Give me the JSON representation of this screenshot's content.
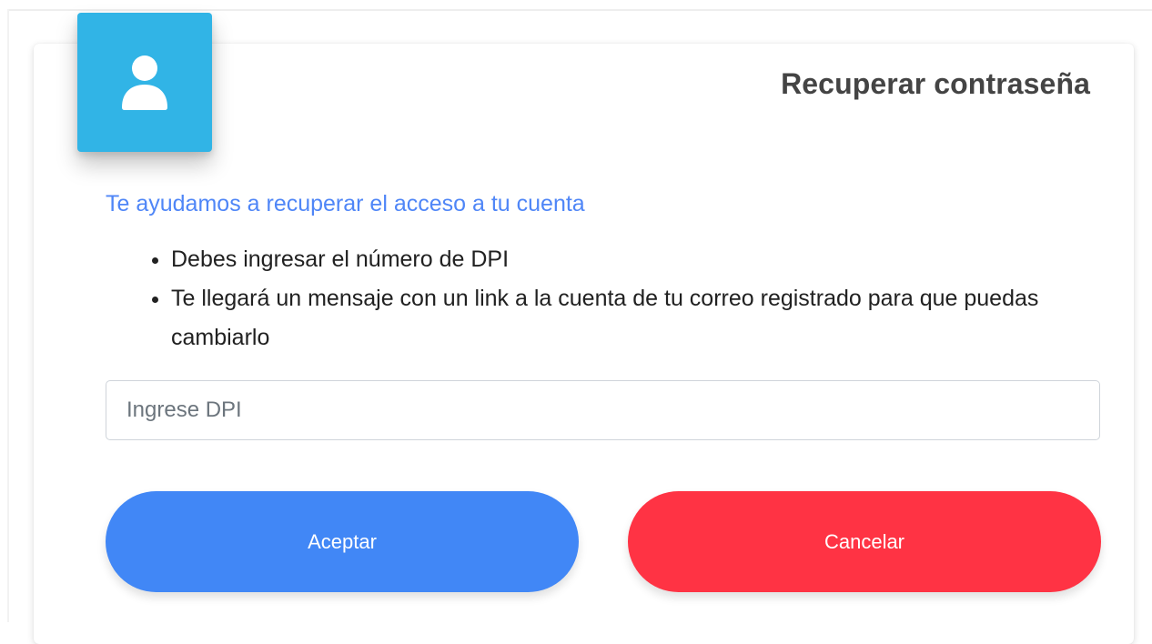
{
  "header": {
    "title": "Recuperar contraseña",
    "icon": "user-icon",
    "icon_bg_color": "#31b4e6"
  },
  "content": {
    "subtitle": "Te ayudamos a recuperar el acceso a tu cuenta",
    "subtitle_color": "#4f86f7",
    "bullets": [
      "Debes ingresar el número de DPI",
      "Te llegará un mensaje con un link a la cuenta de tu correo registrado para que puedas cambiarlo"
    ]
  },
  "form": {
    "dpi_placeholder": "Ingrese DPI",
    "dpi_value": ""
  },
  "actions": {
    "accept_label": "Aceptar",
    "accept_color": "#4187f6",
    "cancel_label": "Cancelar",
    "cancel_color": "#ff3344"
  }
}
